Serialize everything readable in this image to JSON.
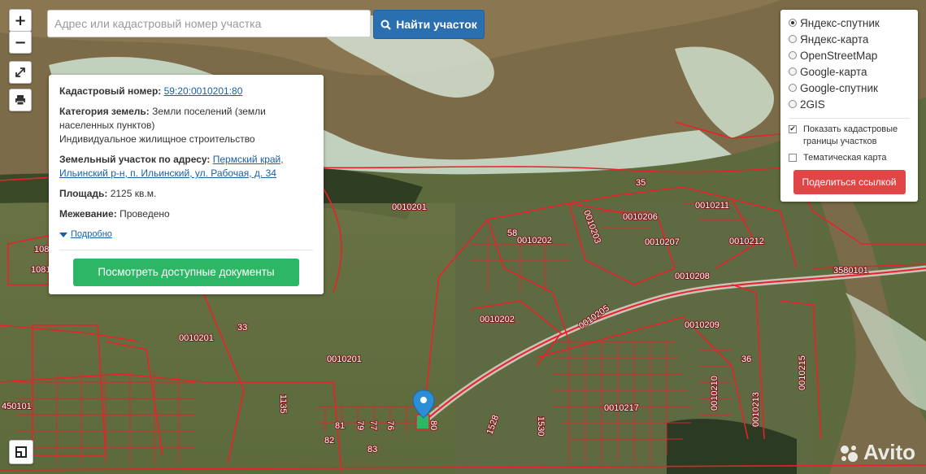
{
  "search": {
    "placeholder": "Адрес или кадастровый номер участка",
    "button_label": "Найти участок"
  },
  "controls": {
    "zoom_in": "+",
    "zoom_out": "−"
  },
  "info": {
    "cadastral_label": "Кадастровый номер:",
    "cadastral_value": "59:20:0010201:80",
    "category_label": "Категория земель:",
    "category_value": "Земли поселений (земли населенных пунктов)",
    "category_use": "Индивидуальное жилищное строительство",
    "address_label": "Земельный участок по адресу:",
    "address_value": "Пермский край, Ильинский р-н, п. Ильинский, ул. Рабочая, д. 34",
    "area_label": "Площадь:",
    "area_value": "2125 кв.м.",
    "survey_label": "Межевание:",
    "survey_value": "Проведено",
    "more_label": "Подробно",
    "docs_button": "Посмотреть доступные документы"
  },
  "layers": {
    "options": [
      "Яндекс-спутник",
      "Яндекс-карта",
      "OpenStreetMap",
      "Google-карта",
      "Google-спутник",
      "2GIS"
    ],
    "selected": "Яндекс-спутник",
    "checkbox_borders": "Показать кадастровые границы участков",
    "checkbox_borders_checked": true,
    "checkbox_thematic": "Тематическая карта",
    "checkbox_thematic_checked": false,
    "share_button": "Поделиться ссылкой"
  },
  "map_labels": [
    "0010201",
    "0010202",
    "0010203",
    "0010206",
    "0010207",
    "0010208",
    "0010211",
    "0010212",
    "0010205",
    "0010209",
    "0010210",
    "0010213",
    "0010215",
    "0010217",
    "3580101",
    "0010201",
    "0010201",
    "0010202",
    "450101",
    "35",
    "58",
    "33",
    "1135",
    "1528",
    "1530",
    "36",
    "81",
    "82",
    "83",
    "79",
    "77",
    "76",
    "80",
    "108",
    "1081"
  ],
  "watermark": "Avito",
  "colors": {
    "search_button": "#2a6fb0",
    "docs_button": "#2db764",
    "share_button": "#e04646",
    "parcel_border": "#e8222a"
  }
}
